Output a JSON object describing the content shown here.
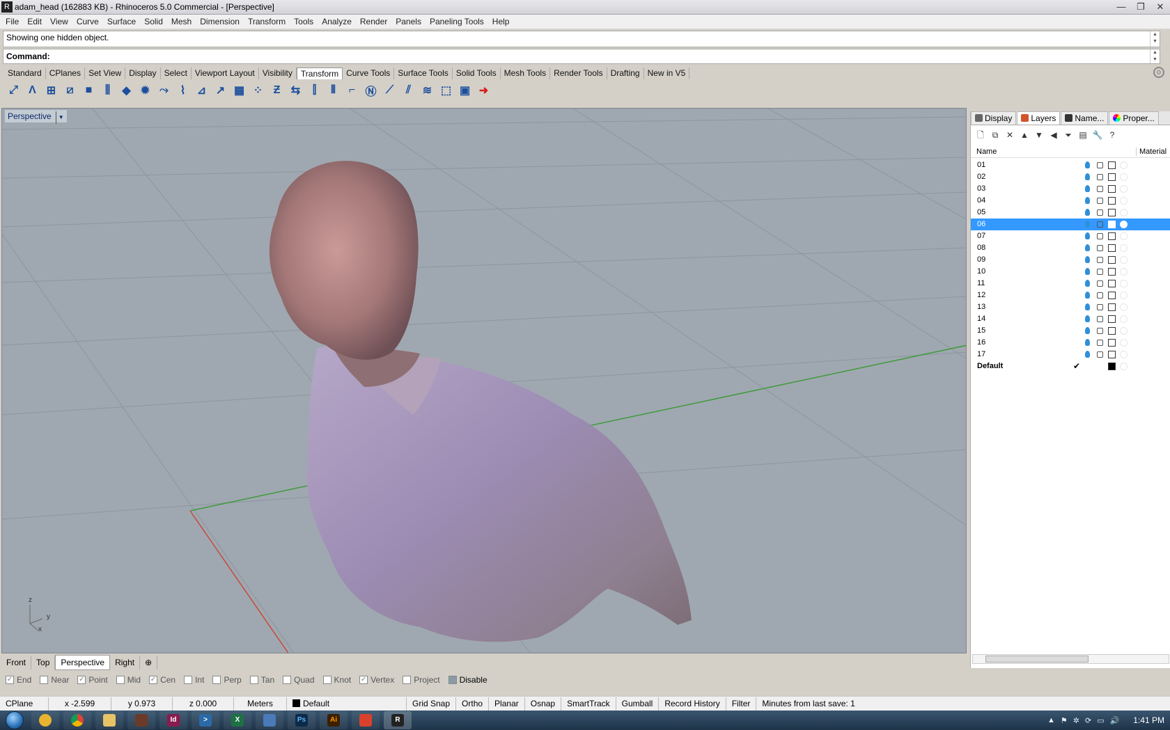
{
  "window": {
    "title": "adam_head (162883 KB) - Rhinoceros 5.0 Commercial - [Perspective]"
  },
  "menu": [
    "File",
    "Edit",
    "View",
    "Curve",
    "Surface",
    "Solid",
    "Mesh",
    "Dimension",
    "Transform",
    "Tools",
    "Analyze",
    "Render",
    "Panels",
    "Paneling Tools",
    "Help"
  ],
  "command": {
    "history": "Showing one hidden object.",
    "prompt": "Command:"
  },
  "toolbar_tabs": [
    "Standard",
    "CPlanes",
    "Set View",
    "Display",
    "Select",
    "Viewport Layout",
    "Visibility",
    "Transform",
    "Curve Tools",
    "Surface Tools",
    "Solid Tools",
    "Mesh Tools",
    "Render Tools",
    "Drafting",
    "New in V5"
  ],
  "toolbar_active_tab": "Transform",
  "tool_icons": [
    "move-icon",
    "rotate-icon",
    "scale-icon",
    "mirror-icon",
    "box-icon",
    "align-icon",
    "orient-icon",
    "array-icon",
    "twist-icon",
    "bend-icon",
    "taper-icon",
    "flow-icon",
    "grid-array-icon",
    "polar-array-icon",
    "project-icon",
    "orient-curve-icon",
    "setpt-icon",
    "smooth-icon",
    "splop-icon",
    "stretch-icon",
    "cage-icon",
    "maelstrom-icon",
    "flow-surface-icon",
    "cage-edit-icon",
    "arrow-icon"
  ],
  "viewport": {
    "title": "Perspective",
    "axes": {
      "z": "z",
      "y": "y",
      "x": "x"
    }
  },
  "viewport_tabs": [
    "Front",
    "Top",
    "Perspective",
    "Right"
  ],
  "viewport_active_tab": "Perspective",
  "osnaps": [
    {
      "label": "End",
      "checked": true
    },
    {
      "label": "Near",
      "checked": false
    },
    {
      "label": "Point",
      "checked": true
    },
    {
      "label": "Mid",
      "checked": false
    },
    {
      "label": "Cen",
      "checked": true
    },
    {
      "label": "Int",
      "checked": false
    },
    {
      "label": "Perp",
      "checked": false
    },
    {
      "label": "Tan",
      "checked": false
    },
    {
      "label": "Quad",
      "checked": false
    },
    {
      "label": "Knot",
      "checked": false
    },
    {
      "label": "Vertex",
      "checked": true
    },
    {
      "label": "Project",
      "checked": false
    },
    {
      "label": "Disable",
      "checked": false
    }
  ],
  "status": {
    "cplane": "CPlane",
    "x": "x -2.599",
    "y": "y 0.973",
    "z": "z 0.000",
    "units": "Meters",
    "layer": "Default",
    "grid_snap": "Grid Snap",
    "ortho": "Ortho",
    "planar": "Planar",
    "osnap": "Osnap",
    "smarttrack": "SmartTrack",
    "gumball": "Gumball",
    "record_history": "Record History",
    "filter": "Filter",
    "save_info": "Minutes from last save: 1"
  },
  "panel": {
    "tabs": [
      "Display",
      "Layers",
      "Name...",
      "Proper..."
    ],
    "active_tab": "Layers",
    "columns": {
      "name": "Name",
      "material": "Material"
    },
    "layers": [
      "01",
      "02",
      "03",
      "04",
      "05",
      "06",
      "07",
      "08",
      "09",
      "10",
      "11",
      "12",
      "13",
      "14",
      "15",
      "16",
      "17",
      "Default"
    ],
    "selected_layer": "06",
    "current_layer": "Default"
  },
  "taskbar": {
    "time": "1:41 PM"
  },
  "colors": {
    "viewport_bg": "#9fa8b0",
    "x_axis": "#c84a3a",
    "y_axis": "#3f9a3a",
    "selection": "#3399ff"
  }
}
